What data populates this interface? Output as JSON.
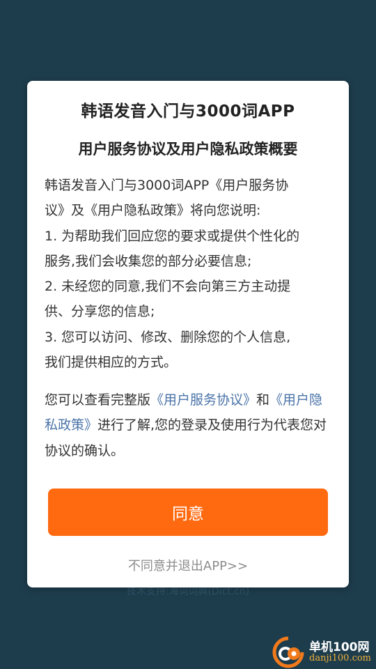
{
  "footer": {
    "credit": "技术支持:海词词典(Dict.cn)"
  },
  "dialog": {
    "app_title": "韩语发音入门与3000词APP",
    "subtitle": "用户服务协议及用户隐私政策概要",
    "body_lines": [
      "韩语发音入门与3000词APP《用户服务协",
      "议》及《用户隐私政策》将向您说明:",
      "1. 为帮助我们回应您的要求或提供个性化的",
      "服务,我们会收集您的部分必要信息;",
      "2. 未经您的同意,我们不会向第三方主动提",
      "供、分享您的信息;",
      "3. 您可以访问、修改、删除您的个人信息,",
      "我们提供相应的方式。"
    ],
    "more": {
      "prefix": "您可以查看完整版",
      "terms_link": "《用户服务协议》",
      "conjunction": "和",
      "privacy_link": "《用户隐私政策》",
      "suffix": "进行了解,您的登录及使用行为代表您对协议的确认。"
    },
    "agree_label": "同意",
    "disagree_label": "不同意并退出APP>>"
  },
  "watermark": {
    "name": "单机100网",
    "url": "danji100.com"
  },
  "colors": {
    "background": "#1d3c4c",
    "accent": "#ff6a10",
    "link": "#4a73a8"
  }
}
